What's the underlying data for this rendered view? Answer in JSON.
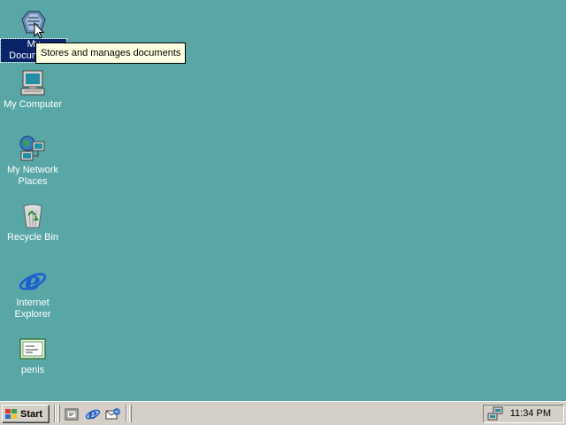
{
  "desktop": {
    "background": "#58a6a6",
    "icons": [
      {
        "label": "My Documents",
        "icon": "my-documents-icon",
        "selected": true
      },
      {
        "label": "My Computer",
        "icon": "my-computer-icon"
      },
      {
        "label": "My Network Places",
        "icon": "network-places-icon"
      },
      {
        "label": "Recycle Bin",
        "icon": "recycle-bin-icon"
      },
      {
        "label": "Internet Explorer",
        "icon": "internet-explorer-icon"
      },
      {
        "label": "penis",
        "icon": "file-icon"
      }
    ],
    "tooltip": "Stores and manages documents"
  },
  "taskbar": {
    "start_label": "Start",
    "quick_launch": [
      "show-desktop-icon",
      "internet-explorer-icon",
      "outlook-express-icon"
    ],
    "clock": "11:34 PM"
  }
}
